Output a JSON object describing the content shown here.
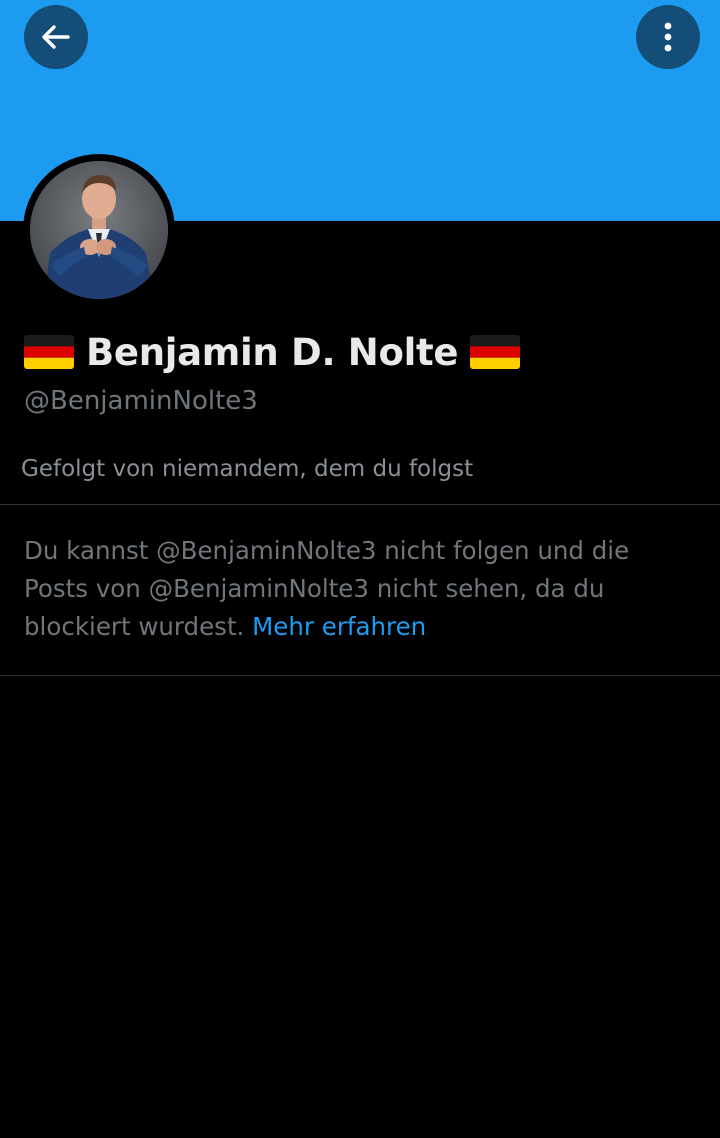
{
  "header": {
    "back_icon": "arrow-left-icon",
    "more_icon": "more-vertical-icon"
  },
  "colors": {
    "banner": "#1d9bf0",
    "background": "#000000",
    "link": "#1d9bf0",
    "muted_text": "#71767b",
    "primary_text": "#e7e9ea"
  },
  "profile": {
    "avatar_icon": "profile-photo",
    "flag_left_icon": "germany-flag-icon",
    "display_name": "Benjamin D. Nolte",
    "flag_right_icon": "germany-flag-icon",
    "handle": "@BenjaminNolte3",
    "followed_by": "Gefolgt von niemandem, dem du folgst"
  },
  "blocked_notice": {
    "text": "Du kannst @BenjaminNolte3 nicht folgen und die\nPosts von @BenjaminNolte3 nicht sehen, da du\nblockiert wurdest. ",
    "link_label": "Mehr erfahren"
  }
}
